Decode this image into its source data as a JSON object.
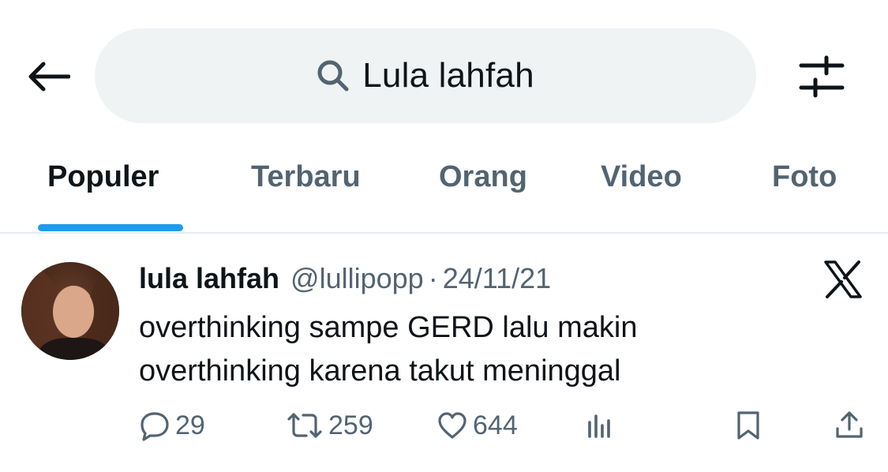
{
  "search": {
    "query": "Lula lahfah"
  },
  "tabs": [
    {
      "label": "Populer",
      "active": true
    },
    {
      "label": "Terbaru",
      "active": false
    },
    {
      "label": "Orang",
      "active": false
    },
    {
      "label": "Video",
      "active": false
    },
    {
      "label": "Foto",
      "active": false
    }
  ],
  "tweet": {
    "author_name": "lula lahfah",
    "handle": "@lullipopp",
    "separator": "·",
    "date": "24/11/21",
    "text_lines": [
      "overthinking sampe GERD lalu makin",
      "overthinking karena takut meninggal"
    ],
    "stats": {
      "replies": "29",
      "reposts": "259",
      "likes": "644"
    }
  },
  "colors": {
    "accent": "#1d9bf0",
    "text_primary": "#0f1419",
    "text_secondary": "#536471",
    "search_bg": "#eff3f4",
    "divider": "#e6ecf0"
  },
  "icons": {
    "back": "arrow-left-icon",
    "search": "search-icon",
    "filter": "sliders-icon",
    "platform": "x-logo-icon",
    "reply": "reply-icon",
    "repost": "repost-icon",
    "like": "heart-icon",
    "views": "views-icon",
    "bookmark": "bookmark-icon",
    "share": "share-icon"
  }
}
